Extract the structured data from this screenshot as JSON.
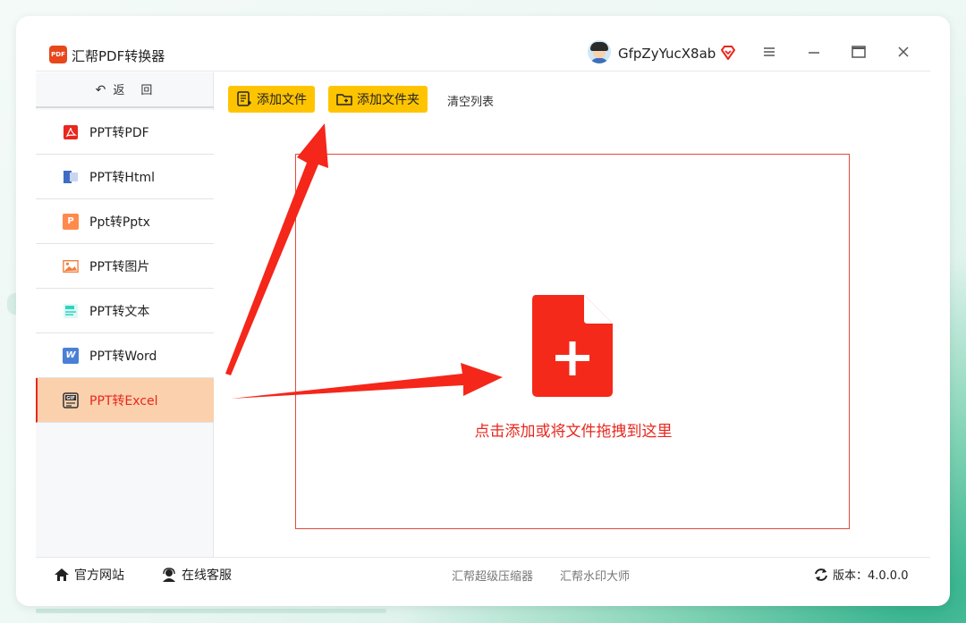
{
  "app": {
    "title": "汇帮PDF转换器",
    "logo_text": "PDF",
    "username": "GfpZyYucX8ab"
  },
  "window_controls": {
    "menu": "≡",
    "minimize": "—",
    "maximize": "▭",
    "close": "✕"
  },
  "sidebar": {
    "back_label": "返",
    "back_label2": "回",
    "items": [
      {
        "label": "PPT转PDF",
        "icon": "pdf-icon"
      },
      {
        "label": "PPT转Html",
        "icon": "html-icon"
      },
      {
        "label": "Ppt转Pptx",
        "icon": "pptx-icon"
      },
      {
        "label": "PPT转图片",
        "icon": "image-icon"
      },
      {
        "label": "PPT转文本",
        "icon": "text-icon"
      },
      {
        "label": "PPT转Word",
        "icon": "word-icon"
      },
      {
        "label": "PPT转Excel",
        "icon": "gif-icon",
        "active": true
      }
    ]
  },
  "toolbar": {
    "add_file": "添加文件",
    "add_folder": "添加文件夹",
    "clear_list": "清空列表"
  },
  "dropzone": {
    "hint": "点击添加或将文件拖拽到这里"
  },
  "footer": {
    "website": "官方网站",
    "support": "在线客服",
    "link_compressor": "汇帮超级压缩器",
    "link_watermark": "汇帮水印大师",
    "version": "版本：4.0.0.0"
  },
  "colors": {
    "accent_yellow": "#ffc400",
    "accent_red": "#e8271e",
    "active_bg": "#fbd0ad"
  }
}
